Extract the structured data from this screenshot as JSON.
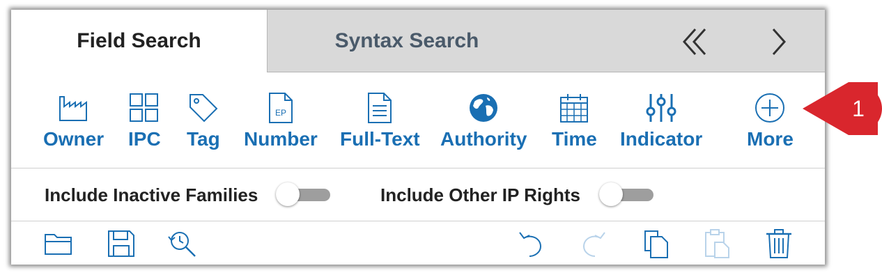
{
  "tabs": {
    "field_search": "Field Search",
    "syntax_search": "Syntax Search"
  },
  "criteria": [
    {
      "label": "Owner",
      "icon": "factory-icon"
    },
    {
      "label": "IPC",
      "icon": "grid-icon"
    },
    {
      "label": "Tag",
      "icon": "tag-icon"
    },
    {
      "label": "Number",
      "icon": "document-ep-icon"
    },
    {
      "label": "Full-Text",
      "icon": "document-text-icon"
    },
    {
      "label": "Authority",
      "icon": "globe-icon"
    },
    {
      "label": "Time",
      "icon": "calendar-icon"
    },
    {
      "label": "Indicator",
      "icon": "sliders-icon"
    },
    {
      "label": "More",
      "icon": "plus-circle-icon"
    }
  ],
  "ep_badge": "EP",
  "toggles": {
    "inactive_families": {
      "label": "Include Inactive Families",
      "on": false
    },
    "other_ip_rights": {
      "label": "Include Other IP Rights",
      "on": false
    }
  },
  "toolbar": [
    "open-folder-icon",
    "save-icon",
    "history-search-icon",
    "undo-icon",
    "redo-icon",
    "copy-icon",
    "paste-icon",
    "trash-icon"
  ],
  "callout": {
    "number": "1",
    "color": "#d9262d"
  },
  "colors": {
    "accent": "#1a6fb3",
    "tab_inactive_bg": "#d9d9d9",
    "toggle_off": "#9e9e9e"
  }
}
